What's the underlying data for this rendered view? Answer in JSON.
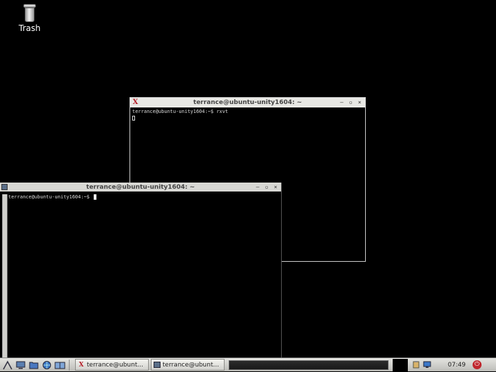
{
  "desktop": {
    "icons": [
      {
        "label": "Trash",
        "icon": "trash-icon"
      }
    ]
  },
  "windows": {
    "rxvt": {
      "title": "terrance@ubuntu-unity1604: ~",
      "buttons": [
        "–",
        "▫",
        "×"
      ],
      "lines": [
        "terrance@ubuntu-unity1604:~$ rxvt"
      ]
    },
    "terminal": {
      "title": "terrance@ubuntu-unity1604: ~",
      "buttons": [
        "–",
        "▫",
        "×"
      ],
      "prompt": "terrance@ubuntu-unity1604:~$ "
    }
  },
  "taskbar": {
    "tasks": [
      {
        "label": "terrance@ubunt...",
        "icon": "rxvt-icon"
      },
      {
        "label": "terrance@ubunt...",
        "icon": "terminal-icon"
      }
    ],
    "clock": "07:49"
  },
  "colors": {
    "desktop": "#000000",
    "titlebar": "#e8e8e4",
    "power": "#c0262d"
  }
}
